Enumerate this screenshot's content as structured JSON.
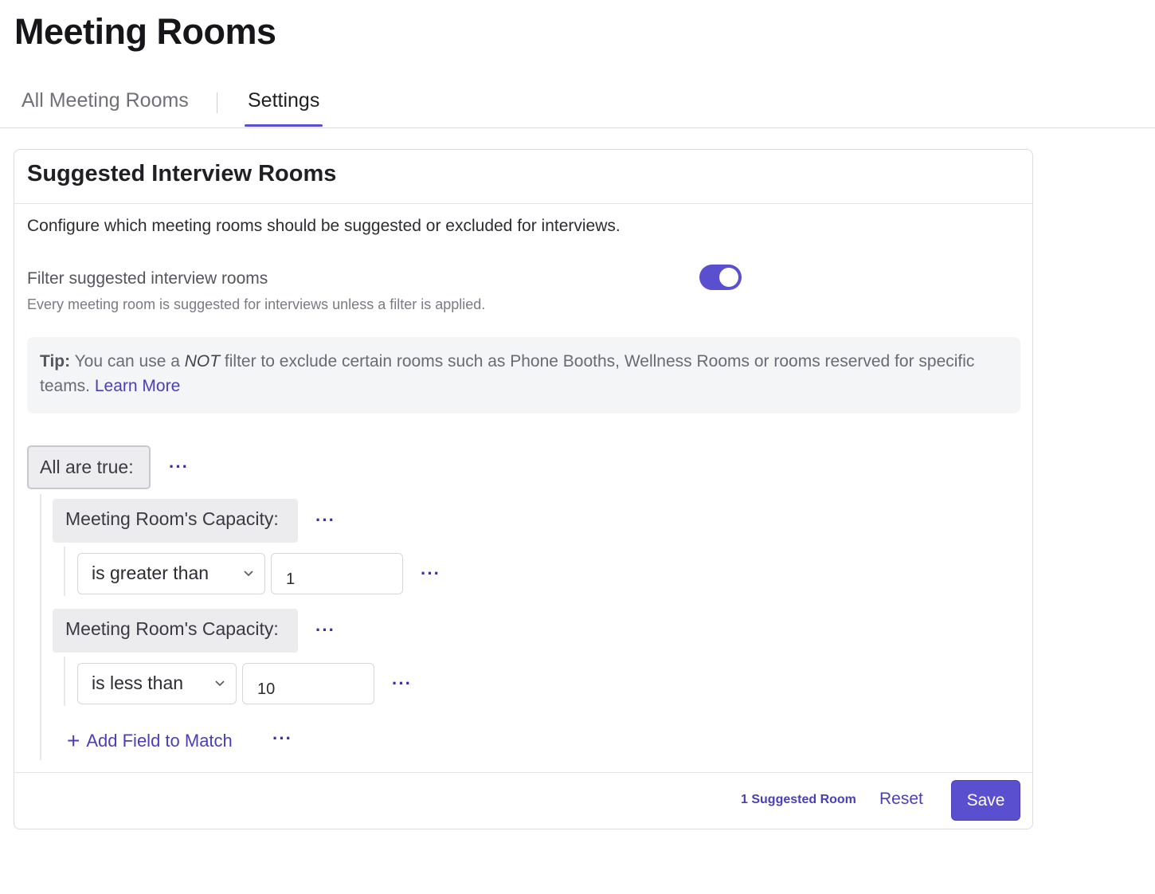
{
  "page": {
    "title": "Meeting Rooms"
  },
  "tabs": [
    {
      "label": "All Meeting Rooms",
      "active": false
    },
    {
      "label": "Settings",
      "active": true
    }
  ],
  "card": {
    "title": "Suggested Interview Rooms",
    "description": "Configure which meeting rooms should be suggested or excluded for interviews.",
    "filter_label": "Filter suggested interview rooms",
    "filter_help": "Every meeting room is suggested for interviews unless a filter is applied.",
    "filter_enabled": true,
    "tip": {
      "prefix": "Tip:",
      "text_before": " You can use a ",
      "emphasis": "NOT",
      "text_after": " filter to exclude certain rooms such as Phone Booths, Wellness Rooms or rooms reserved for specific teams. ",
      "link": "Learn More"
    },
    "group_label": "All are true:",
    "more_icon": "···",
    "conditions": [
      {
        "field": "Meeting Room's Capacity:",
        "operator": "is greater than",
        "value": "1"
      },
      {
        "field": "Meeting Room's Capacity:",
        "operator": "is less than",
        "value": "10"
      }
    ],
    "add_field_label": "Add Field to Match",
    "add_icon": "+",
    "footer": {
      "suggested_count": "1 Suggested Room",
      "reset_label": "Reset",
      "save_label": "Save"
    }
  },
  "colors": {
    "accent": "#5a4fcf",
    "link": "#4a3fb8",
    "tip_bg": "#f3f5f7"
  }
}
